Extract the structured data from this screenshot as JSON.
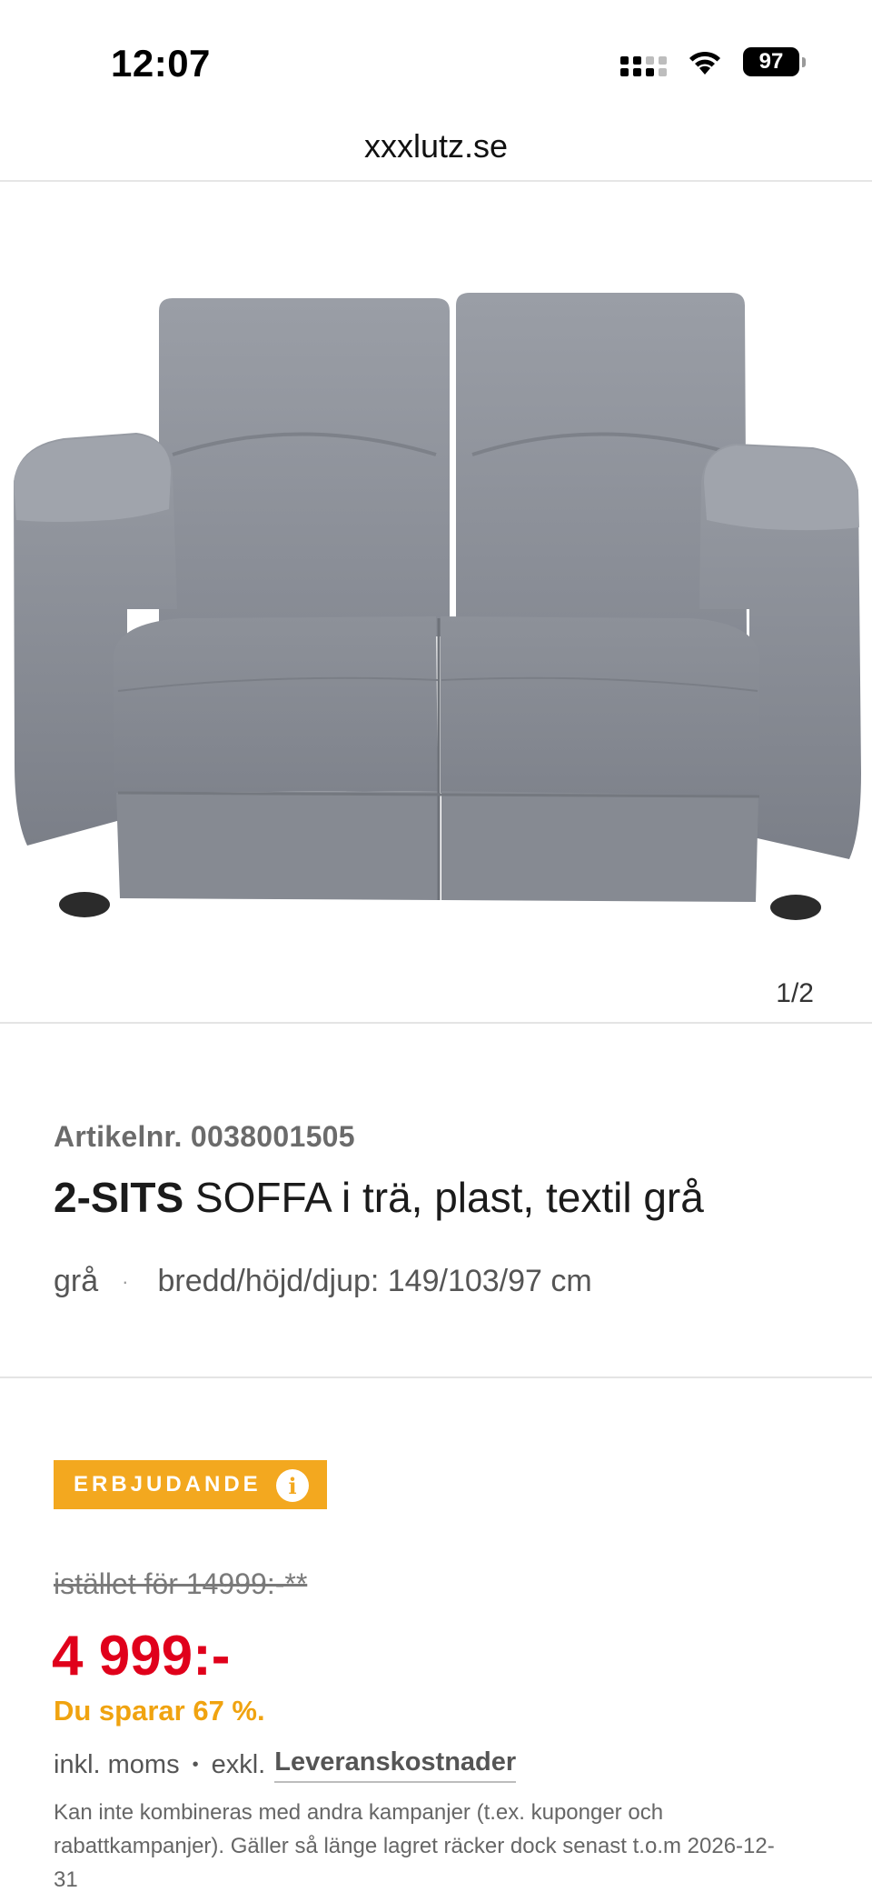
{
  "status_bar": {
    "time": "12:07",
    "battery": "97"
  },
  "browser": {
    "url": "xxxlutz.se"
  },
  "gallery": {
    "counter": "1/2"
  },
  "product": {
    "article_no": "Artikelnr. 0038001505",
    "title_bold": "2-SITS",
    "title_rest": " SOFFA i trä, plast, textil grå",
    "color": "grå",
    "dimensions": "bredd/höjd/djup: 149/103/97 cm"
  },
  "offer": {
    "badge_label": "ERBJUDANDE",
    "info_icon": "i",
    "old_price": "istället för 14999:-**",
    "new_price": "4 999:-",
    "saving": "Du sparar 67 %.",
    "vat_included": "inkl. moms",
    "excl_label": "exkl.",
    "delivery_link": "Leveranskostnader",
    "disclaimer": "Kan inte kombineras med andra kampanjer (t.ex. kuponger och rabattkampanjer). Gäller så länge lagret räcker dock senast t.o.m 2026-12-31"
  },
  "colors": {
    "accent_orange": "#f3a81f",
    "price_red": "#e0001b",
    "sofa_gray": "#8f939b"
  }
}
